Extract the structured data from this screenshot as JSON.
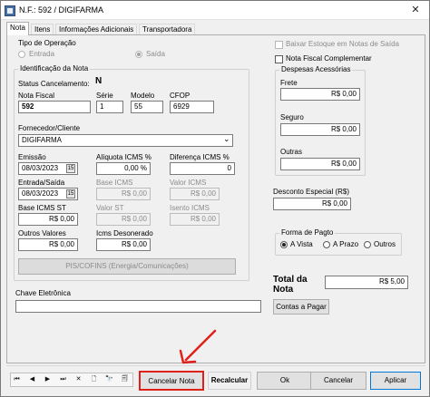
{
  "window": {
    "title": "N.F.: 592 / DIGIFARMA",
    "close_glyph": "✕"
  },
  "tabs": [
    {
      "label": "Nota"
    },
    {
      "label": "Itens"
    },
    {
      "label": "Informações Adicionais"
    },
    {
      "label": "Transportadora"
    }
  ],
  "tipo_operacao": {
    "title": "Tipo de Operação",
    "entrada": "Entrada",
    "saida": "Saída",
    "selected": "Saída"
  },
  "checkboxes": {
    "baixar_estoque": "Baixar Estoque em Notas de Saída",
    "nota_complementar": "Nota Fiscal Complementar"
  },
  "identificacao": {
    "title": "Identificação da Nota",
    "status_label": "Status Cancelamento:",
    "status_value": "N",
    "nota_fiscal_label": "Nota Fiscal",
    "nota_fiscal_value": "592",
    "serie_label": "Série",
    "serie_value": "1",
    "modelo_label": "Modelo",
    "modelo_value": "55",
    "cfop_label": "CFOP",
    "cfop_value": "6929",
    "fornecedor_label": "Fornecedor/Cliente",
    "fornecedor_value": "DIGIFARMA",
    "emissao_label": "Emissão",
    "emissao_value": "08/03/2023",
    "entrada_saida_label": "Entrada/Saída",
    "entrada_saida_value": "08/03/2023",
    "aliquota_label": "Alíquota ICMS %",
    "aliquota_value": "0,00 %",
    "diferenca_label": "Diferença ICMS %",
    "diferenca_value": "0",
    "base_icms_label": "Base ICMS",
    "base_icms_value": "R$ 0,00",
    "valor_icms_label": "Valor ICMS",
    "valor_icms_value": "R$ 0,00",
    "base_icms_st_label": "Base ICMS ST",
    "base_icms_st_value": "R$ 0,00",
    "valor_st_label": "Valor ST",
    "valor_st_value": "R$ 0,00",
    "isento_icms_label": "Isento ICMS",
    "isento_icms_value": "R$ 0,00",
    "outros_valores_label": "Outros Valores",
    "outros_valores_value": "R$ 0,00",
    "icms_desonerado_label": "Icms Desonerado",
    "icms_desonerado_value": "R$ 0,00",
    "pis_cofins_button": "PIS/COFINS (Energia/Comunicações)"
  },
  "chave": {
    "label": "Chave Eletrônica",
    "value": ""
  },
  "despesas": {
    "title": "Despesas Acessórias",
    "frete_label": "Frete",
    "frete_value": "R$ 0,00",
    "seguro_label": "Seguro",
    "seguro_value": "R$ 0,00",
    "outras_label": "Outras",
    "outras_value": "R$ 0,00"
  },
  "desconto": {
    "label": "Desconto Especial (R$)",
    "value": "R$ 0,00"
  },
  "pagamento": {
    "title": "Forma de Pagto",
    "a_vista": "A Vista",
    "a_prazo": "A Prazo",
    "outros": "Outros",
    "selected": "A Vista"
  },
  "total": {
    "label_line1": "Total da",
    "label_line2": "Nota",
    "value": "R$ 5,00"
  },
  "contas_button": "Contas a Pagar",
  "date_btn_glyph": "15",
  "dropdown_glyph": "⌄",
  "nav_glyphs": [
    "⏮",
    "◀",
    "▶",
    "⏭",
    "✕",
    "🗋",
    "🔭",
    "🗐"
  ],
  "footer": {
    "cancelar_nota": "Cancelar Nota",
    "recalcular": "Recalcular",
    "ok": "Ok",
    "cancelar": "Cancelar",
    "aplicar": "Aplicar"
  },
  "colors": {
    "annotation_red": "#e0201b",
    "aplicar_border": "#0078d7"
  }
}
